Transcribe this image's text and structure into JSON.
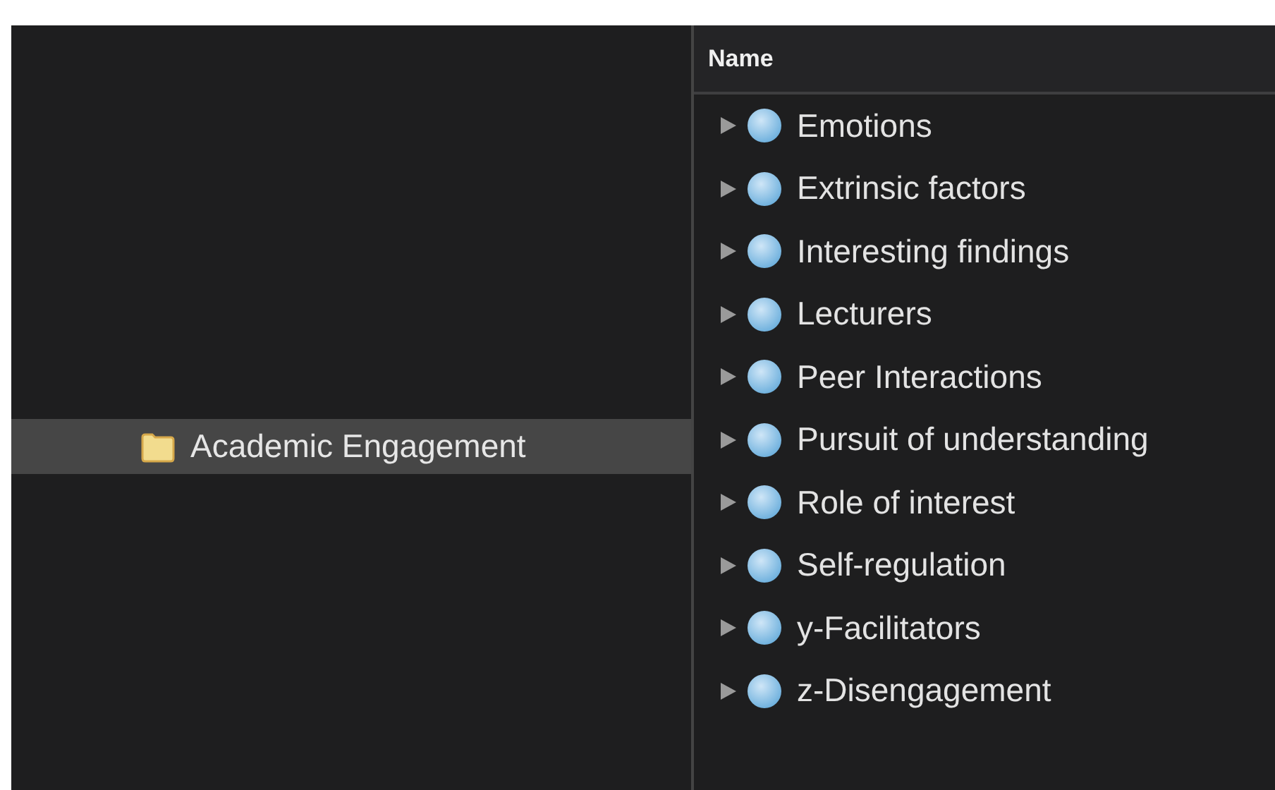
{
  "sidebar": {
    "items": [
      {
        "label": "Academic Engagement",
        "selected": true
      }
    ]
  },
  "table": {
    "columns": [
      "Name"
    ],
    "rows": [
      {
        "name": "Emotions",
        "expanded": false
      },
      {
        "name": "Extrinsic factors",
        "expanded": false
      },
      {
        "name": "Interesting findings",
        "expanded": false
      },
      {
        "name": "Lecturers",
        "expanded": false
      },
      {
        "name": "Peer Interactions",
        "expanded": false
      },
      {
        "name": "Pursuit of understanding",
        "expanded": false
      },
      {
        "name": "Role of interest",
        "expanded": false
      },
      {
        "name": "Self-regulation",
        "expanded": false
      },
      {
        "name": "y-Facilitators",
        "expanded": false
      },
      {
        "name": "z-Disengagement",
        "expanded": false
      }
    ]
  }
}
